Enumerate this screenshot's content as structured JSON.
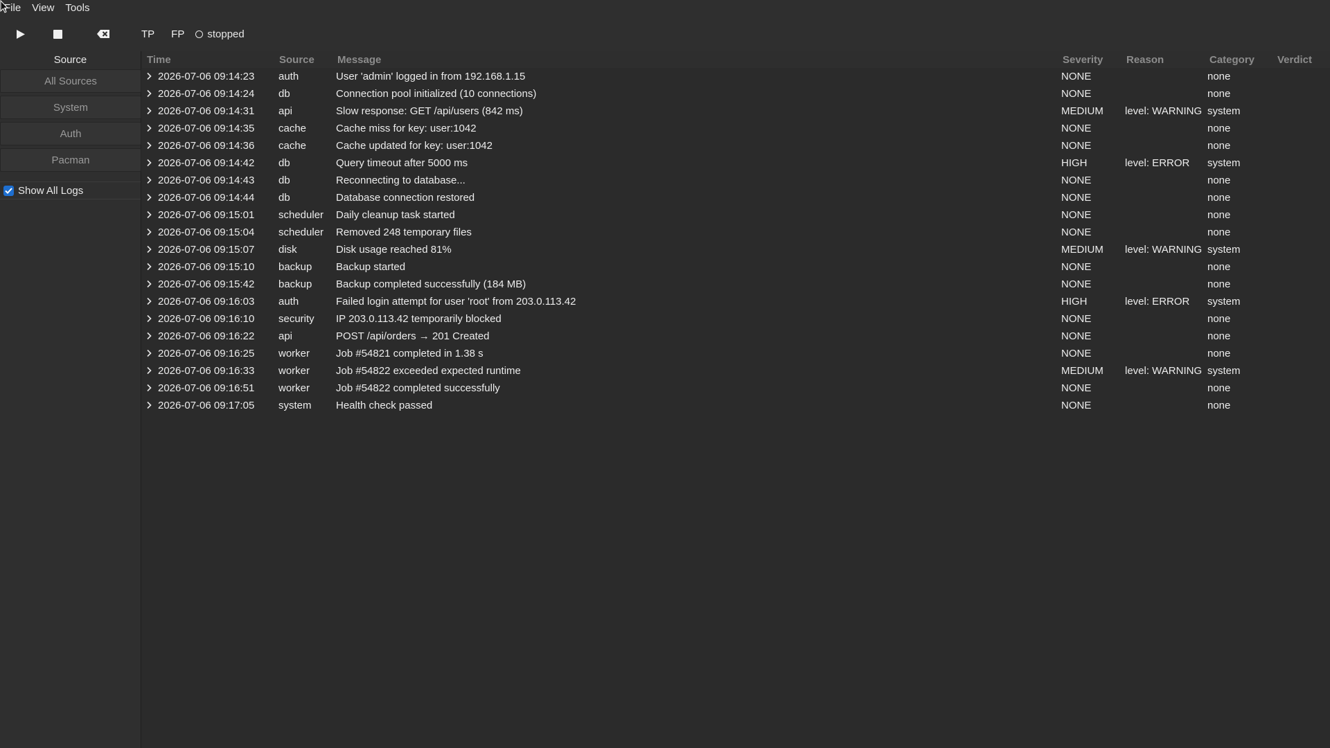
{
  "menu": [
    "File",
    "View",
    "Tools"
  ],
  "toolbar": {
    "play_icon": "play-icon",
    "stop_icon": "stop-icon",
    "clear_icon": "clear-icon",
    "tp_label": "TP",
    "fp_label": "FP",
    "status": "stopped"
  },
  "sidebar": {
    "title": "Source",
    "sources": [
      "All Sources",
      "System",
      "Auth",
      "Pacman"
    ],
    "show_all_label": "Show All Logs",
    "show_all_checked": true
  },
  "table": {
    "headers": {
      "time": "Time",
      "source": "Source",
      "message": "Message",
      "severity": "Severity",
      "reason": "Reason",
      "category": "Category",
      "verdict": "Verdict"
    },
    "rows": [
      {
        "time": "2026-07-06 09:14:23",
        "source": "auth",
        "message": "User 'admin' logged in from 192.168.1.15",
        "severity": "NONE",
        "reason": "",
        "category": "none",
        "verdict": ""
      },
      {
        "time": "2026-07-06 09:14:24",
        "source": "db",
        "message": "Connection pool initialized (10 connections)",
        "severity": "NONE",
        "reason": "",
        "category": "none",
        "verdict": ""
      },
      {
        "time": "2026-07-06 09:14:31",
        "source": "api",
        "message": "Slow response: GET /api/users (842 ms)",
        "severity": "MEDIUM",
        "reason": "level: WARNING",
        "category": "system",
        "verdict": ""
      },
      {
        "time": "2026-07-06 09:14:35",
        "source": "cache",
        "message": "Cache miss for key: user:1042",
        "severity": "NONE",
        "reason": "",
        "category": "none",
        "verdict": ""
      },
      {
        "time": "2026-07-06 09:14:36",
        "source": "cache",
        "message": "Cache updated for key: user:1042",
        "severity": "NONE",
        "reason": "",
        "category": "none",
        "verdict": ""
      },
      {
        "time": "2026-07-06 09:14:42",
        "source": "db",
        "message": "Query timeout after 5000 ms",
        "severity": "HIGH",
        "reason": "level: ERROR",
        "category": "system",
        "verdict": ""
      },
      {
        "time": "2026-07-06 09:14:43",
        "source": "db",
        "message": "Reconnecting to database...",
        "severity": "NONE",
        "reason": "",
        "category": "none",
        "verdict": ""
      },
      {
        "time": "2026-07-06 09:14:44",
        "source": "db",
        "message": "Database connection restored",
        "severity": "NONE",
        "reason": "",
        "category": "none",
        "verdict": ""
      },
      {
        "time": "2026-07-06 09:15:01",
        "source": "scheduler",
        "message": "Daily cleanup task started",
        "severity": "NONE",
        "reason": "",
        "category": "none",
        "verdict": ""
      },
      {
        "time": "2026-07-06 09:15:04",
        "source": "scheduler",
        "message": "Removed 248 temporary files",
        "severity": "NONE",
        "reason": "",
        "category": "none",
        "verdict": ""
      },
      {
        "time": "2026-07-06 09:15:07",
        "source": "disk",
        "message": "Disk usage reached 81%",
        "severity": "MEDIUM",
        "reason": "level: WARNING",
        "category": "system",
        "verdict": ""
      },
      {
        "time": "2026-07-06 09:15:10",
        "source": "backup",
        "message": "Backup started",
        "severity": "NONE",
        "reason": "",
        "category": "none",
        "verdict": ""
      },
      {
        "time": "2026-07-06 09:15:42",
        "source": "backup",
        "message": "Backup completed successfully (184 MB)",
        "severity": "NONE",
        "reason": "",
        "category": "none",
        "verdict": ""
      },
      {
        "time": "2026-07-06 09:16:03",
        "source": "auth",
        "message": "Failed login attempt for user 'root' from 203.0.113.42",
        "severity": "HIGH",
        "reason": "level: ERROR",
        "category": "system",
        "verdict": ""
      },
      {
        "time": "2026-07-06 09:16:10",
        "source": "security",
        "message": "IP 203.0.113.42 temporarily blocked",
        "severity": "NONE",
        "reason": "",
        "category": "none",
        "verdict": ""
      },
      {
        "time": "2026-07-06 09:16:22",
        "source": "api",
        "message": "POST /api/orders → 201 Created",
        "severity": "NONE",
        "reason": "",
        "category": "none",
        "verdict": ""
      },
      {
        "time": "2026-07-06 09:16:25",
        "source": "worker",
        "message": "Job #54821 completed in 1.38 s",
        "severity": "NONE",
        "reason": "",
        "category": "none",
        "verdict": ""
      },
      {
        "time": "2026-07-06 09:16:33",
        "source": "worker",
        "message": "Job #54822 exceeded expected runtime",
        "severity": "MEDIUM",
        "reason": "level: WARNING",
        "category": "system",
        "verdict": ""
      },
      {
        "time": "2026-07-06 09:16:51",
        "source": "worker",
        "message": "Job #54822 completed successfully",
        "severity": "NONE",
        "reason": "",
        "category": "none",
        "verdict": ""
      },
      {
        "time": "2026-07-06 09:17:05",
        "source": "system",
        "message": "Health check passed",
        "severity": "NONE",
        "reason": "",
        "category": "none",
        "verdict": ""
      }
    ]
  },
  "colors": {
    "background": "#2b2b2b",
    "checkbox_accent": "#1e6fd0"
  }
}
